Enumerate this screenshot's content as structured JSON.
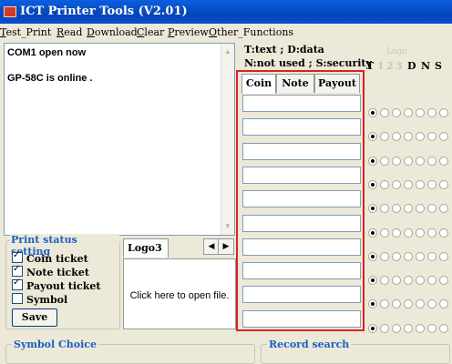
{
  "window": {
    "title": "ICT Printer Tools (V2.01)"
  },
  "menu": [
    {
      "label": "Test_Print",
      "mnemonic": "T",
      "rest": "est_Print"
    },
    {
      "label": "Read",
      "mnemonic": "R",
      "rest": "ead"
    },
    {
      "label": "Download",
      "mnemonic": "D",
      "rest": "ownload"
    },
    {
      "label": "Clear",
      "mnemonic": "C",
      "rest": "lear"
    },
    {
      "label": "Preview",
      "mnemonic": "P",
      "rest": "review"
    },
    {
      "label": "Other_Functions",
      "mnemonic": "O",
      "rest": "ther_Functions"
    }
  ],
  "log": {
    "lines": [
      "COM1  open now",
      "GP-58C is online ."
    ]
  },
  "legend": {
    "line1": "T:text ; D:data",
    "line2": "N:not used ; S:security"
  },
  "mode_header": {
    "t": "T",
    "dim1": "1",
    "dim2": "2",
    "dim3": "3",
    "d": "D",
    "n": "N",
    "s": "S",
    "logo": "Logo"
  },
  "columns": {
    "coin": "Coin",
    "note": "Note",
    "payout": "Payout"
  },
  "rows": [
    {
      "value": "",
      "selected": 0
    },
    {
      "value": "",
      "selected": 0
    },
    {
      "value": "",
      "selected": 0
    },
    {
      "value": "",
      "selected": 0
    },
    {
      "value": "",
      "selected": 0
    },
    {
      "value": "",
      "selected": 0
    },
    {
      "value": "",
      "selected": 0
    },
    {
      "value": "",
      "selected": 0
    },
    {
      "value": "",
      "selected": 0
    },
    {
      "value": "",
      "selected": 0
    }
  ],
  "print_status": {
    "title": "Print status setting",
    "options": [
      {
        "label": "Coin ticket",
        "checked": true
      },
      {
        "label": "Note ticket",
        "checked": true
      },
      {
        "label": "Payout ticket",
        "checked": true
      },
      {
        "label": "Symbol",
        "checked": false
      }
    ],
    "save_label": "Save"
  },
  "logo_panel": {
    "tab_label": "Logo3",
    "hint": "Click here to open file.",
    "prev": "◀",
    "next": "▶"
  },
  "bottom": {
    "symbol_choice": "Symbol Choice",
    "record_search": "Record search"
  },
  "colors": {
    "title_bar": "#0544b8",
    "highlight": "#e0201e",
    "group_legend": "#1a5fc4"
  }
}
